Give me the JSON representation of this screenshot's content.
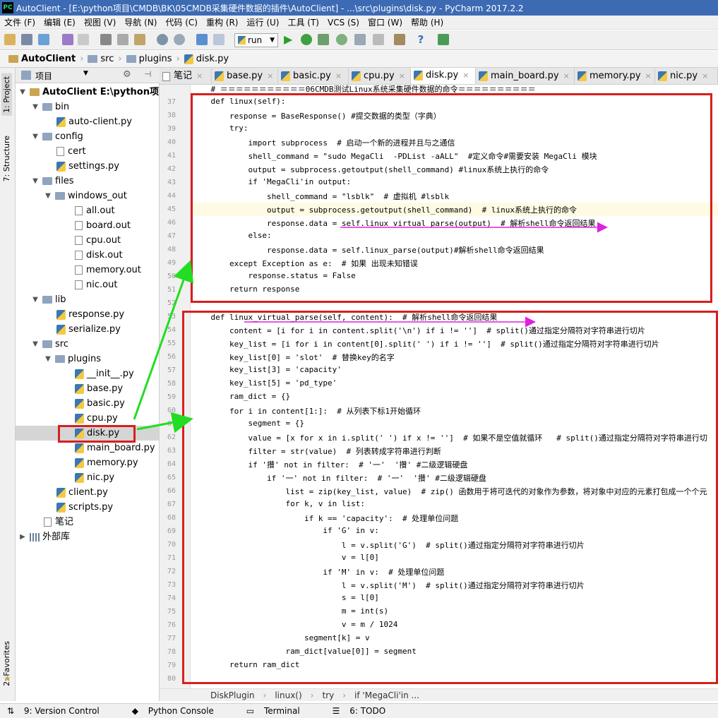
{
  "window_title": "AutoClient - [E:\\python项目\\CMDB\\BK\\05CMDB采集硬件数据的插件\\AutoClient] - ...\\src\\plugins\\disk.py - PyCharm 2017.2.2",
  "app_badge": "PC",
  "menu": [
    "文件 (F)",
    "编辑 (E)",
    "视图 (V)",
    "导航 (N)",
    "代码 (C)",
    "重构 (R)",
    "运行 (U)",
    "工具 (T)",
    "VCS (S)",
    "窗口 (W)",
    "帮助 (H)"
  ],
  "toolbar": {
    "run_config": "run"
  },
  "breadcrumb": [
    "AutoClient",
    "src",
    "plugins",
    "disk.py"
  ],
  "left_tabs": [
    "1: Project",
    "7: Structure",
    "2: Favorites"
  ],
  "project_panel": {
    "title": "项目"
  },
  "tree": [
    {
      "label": "AutoClient  E:\\python项目\\C",
      "bold": true
    },
    {
      "label": "bin"
    },
    {
      "label": "auto-client.py"
    },
    {
      "label": "config"
    },
    {
      "label": "cert"
    },
    {
      "label": "settings.py"
    },
    {
      "label": "files"
    },
    {
      "label": "windows_out"
    },
    {
      "label": "all.out"
    },
    {
      "label": "board.out"
    },
    {
      "label": "cpu.out"
    },
    {
      "label": "disk.out"
    },
    {
      "label": "memory.out"
    },
    {
      "label": "nic.out"
    },
    {
      "label": "lib"
    },
    {
      "label": "response.py"
    },
    {
      "label": "serialize.py"
    },
    {
      "label": "src"
    },
    {
      "label": "plugins"
    },
    {
      "label": "__init__.py"
    },
    {
      "label": "base.py"
    },
    {
      "label": "basic.py"
    },
    {
      "label": "cpu.py"
    },
    {
      "label": "disk.py"
    },
    {
      "label": "main_board.py"
    },
    {
      "label": "memory.py"
    },
    {
      "label": "nic.py"
    },
    {
      "label": "client.py"
    },
    {
      "label": "scripts.py"
    },
    {
      "label": "笔记"
    },
    {
      "label": "外部库"
    }
  ],
  "tabs": [
    "笔记",
    "base.py",
    "basic.py",
    "cpu.py",
    "disk.py",
    "main_board.py",
    "memory.py",
    "nic.py"
  ],
  "code_lines": [
    {
      "n": "",
      "t": "    # ＝＝＝＝＝＝＝＝＝＝＝06CMDB测试Linux系统采集硬件数据的命令＝＝＝＝＝＝＝＝＝＝"
    },
    {
      "n": "37",
      "t": "    def linux(self):"
    },
    {
      "n": "38",
      "t": "        response = BaseResponse() #提交数据的类型（字典）"
    },
    {
      "n": "39",
      "t": "        try:"
    },
    {
      "n": "40",
      "t": "            import subprocess  # 启动一个新的进程并且与之通信"
    },
    {
      "n": "41",
      "t": "            shell_command = \"sudo MegaCli  -PDList -aALL\"  #定义命令#需要安装 MegaCli 模块"
    },
    {
      "n": "42",
      "t": "            output = subprocess.getoutput(shell_command) #linux系统上执行的命令"
    },
    {
      "n": "43",
      "t": "            if 'MegaCli'in output:"
    },
    {
      "n": "44",
      "t": "                shell_command = \"lsblk\"  # 虚拟机 #lsblk"
    },
    {
      "n": "45",
      "t": "                output = subprocess.getoutput(shell_command)  # linux系统上执行的命令"
    },
    {
      "n": "46",
      "t": "                response.data = self.linux_virtual_parse(output)  # 解析shell命令返回结果"
    },
    {
      "n": "47",
      "t": "            else:"
    },
    {
      "n": "48",
      "t": "                response.data = self.linux_parse(output)#解析shell命令返回结果"
    },
    {
      "n": "49",
      "t": "        except Exception as e:  # 如果 出现未知错误"
    },
    {
      "n": "50",
      "t": "            response.status = False"
    },
    {
      "n": "51",
      "t": "        return response"
    },
    {
      "n": "52",
      "t": ""
    },
    {
      "n": "53",
      "t": "    def linux_virtual_parse(self, content):  # 解析shell命令返回结果"
    },
    {
      "n": "54",
      "t": "        content = [i for i in content.split('\\n') if i != '']  # split()通过指定分隔符对字符串进行切片"
    },
    {
      "n": "55",
      "t": "        key_list = [i for i in content[0].split(' ') if i != '']  # split()通过指定分隔符对字符串进行切片"
    },
    {
      "n": "56",
      "t": "        key_list[0] = 'slot'  # 替换key的名字"
    },
    {
      "n": "57",
      "t": "        key_list[3] = 'capacity'"
    },
    {
      "n": "58",
      "t": "        key_list[5] = 'pd_type'"
    },
    {
      "n": "59",
      "t": "        ram_dict = {}"
    },
    {
      "n": "60",
      "t": "        for i in content[1:]:  # 从列表下标1开始循环"
    },
    {
      "n": "61",
      "t": "            segment = {}"
    },
    {
      "n": "62",
      "t": "            value = [x for x in i.split(' ') if x != '']  # 如果不是空值就循环   # split()通过指定分隔符对字符串进行切"
    },
    {
      "n": "63",
      "t": "            filter = str(value)  # 列表转成字符串进行判断"
    },
    {
      "n": "64",
      "t": "            if '攢' not in filter:  # '一'  '攢' #二级逻辑硬盘"
    },
    {
      "n": "65",
      "t": "                if '一' not in filter:  # '一'  '攢' #二级逻辑硬盘"
    },
    {
      "n": "66",
      "t": "                    list = zip(key_list, value)  # zip() 函数用于将可迭代的对象作为参数，将对象中对应的元素打包成一个个元"
    },
    {
      "n": "67",
      "t": "                    for k, v in list:"
    },
    {
      "n": "68",
      "t": "                        if k == 'capacity':  # 处理单位问题"
    },
    {
      "n": "69",
      "t": "                            if 'G' in v:"
    },
    {
      "n": "70",
      "t": "                                l = v.split('G')  # split()通过指定分隔符对字符串进行切片"
    },
    {
      "n": "71",
      "t": "                                v = l[0]"
    },
    {
      "n": "72",
      "t": "                            if 'M' in v:  # 处理单位问题"
    },
    {
      "n": "73",
      "t": "                                l = v.split('M')  # split()通过指定分隔符对字符串进行切片"
    },
    {
      "n": "74",
      "t": "                                s = l[0]"
    },
    {
      "n": "75",
      "t": "                                m = int(s)"
    },
    {
      "n": "76",
      "t": "                                v = m / 1024"
    },
    {
      "n": "77",
      "t": "                        segment[k] = v"
    },
    {
      "n": "78",
      "t": "                    ram_dict[value[0]] = segment"
    },
    {
      "n": "79",
      "t": "        return ram_dict"
    },
    {
      "n": "80",
      "t": ""
    }
  ],
  "code_breadcrumb": [
    "DiskPlugin",
    "linux()",
    "try",
    "if 'MegaCli'in ..."
  ],
  "status": [
    "9: Version Control",
    "Python Console",
    "Terminal",
    "6: TODO"
  ],
  "colors": {
    "title_bar": "#3c6bb4",
    "annotation_box": "#d81e1e",
    "annotation_arrow": "#22dd22",
    "annotation_underline": "#e020e0",
    "keyword": "#000080"
  }
}
